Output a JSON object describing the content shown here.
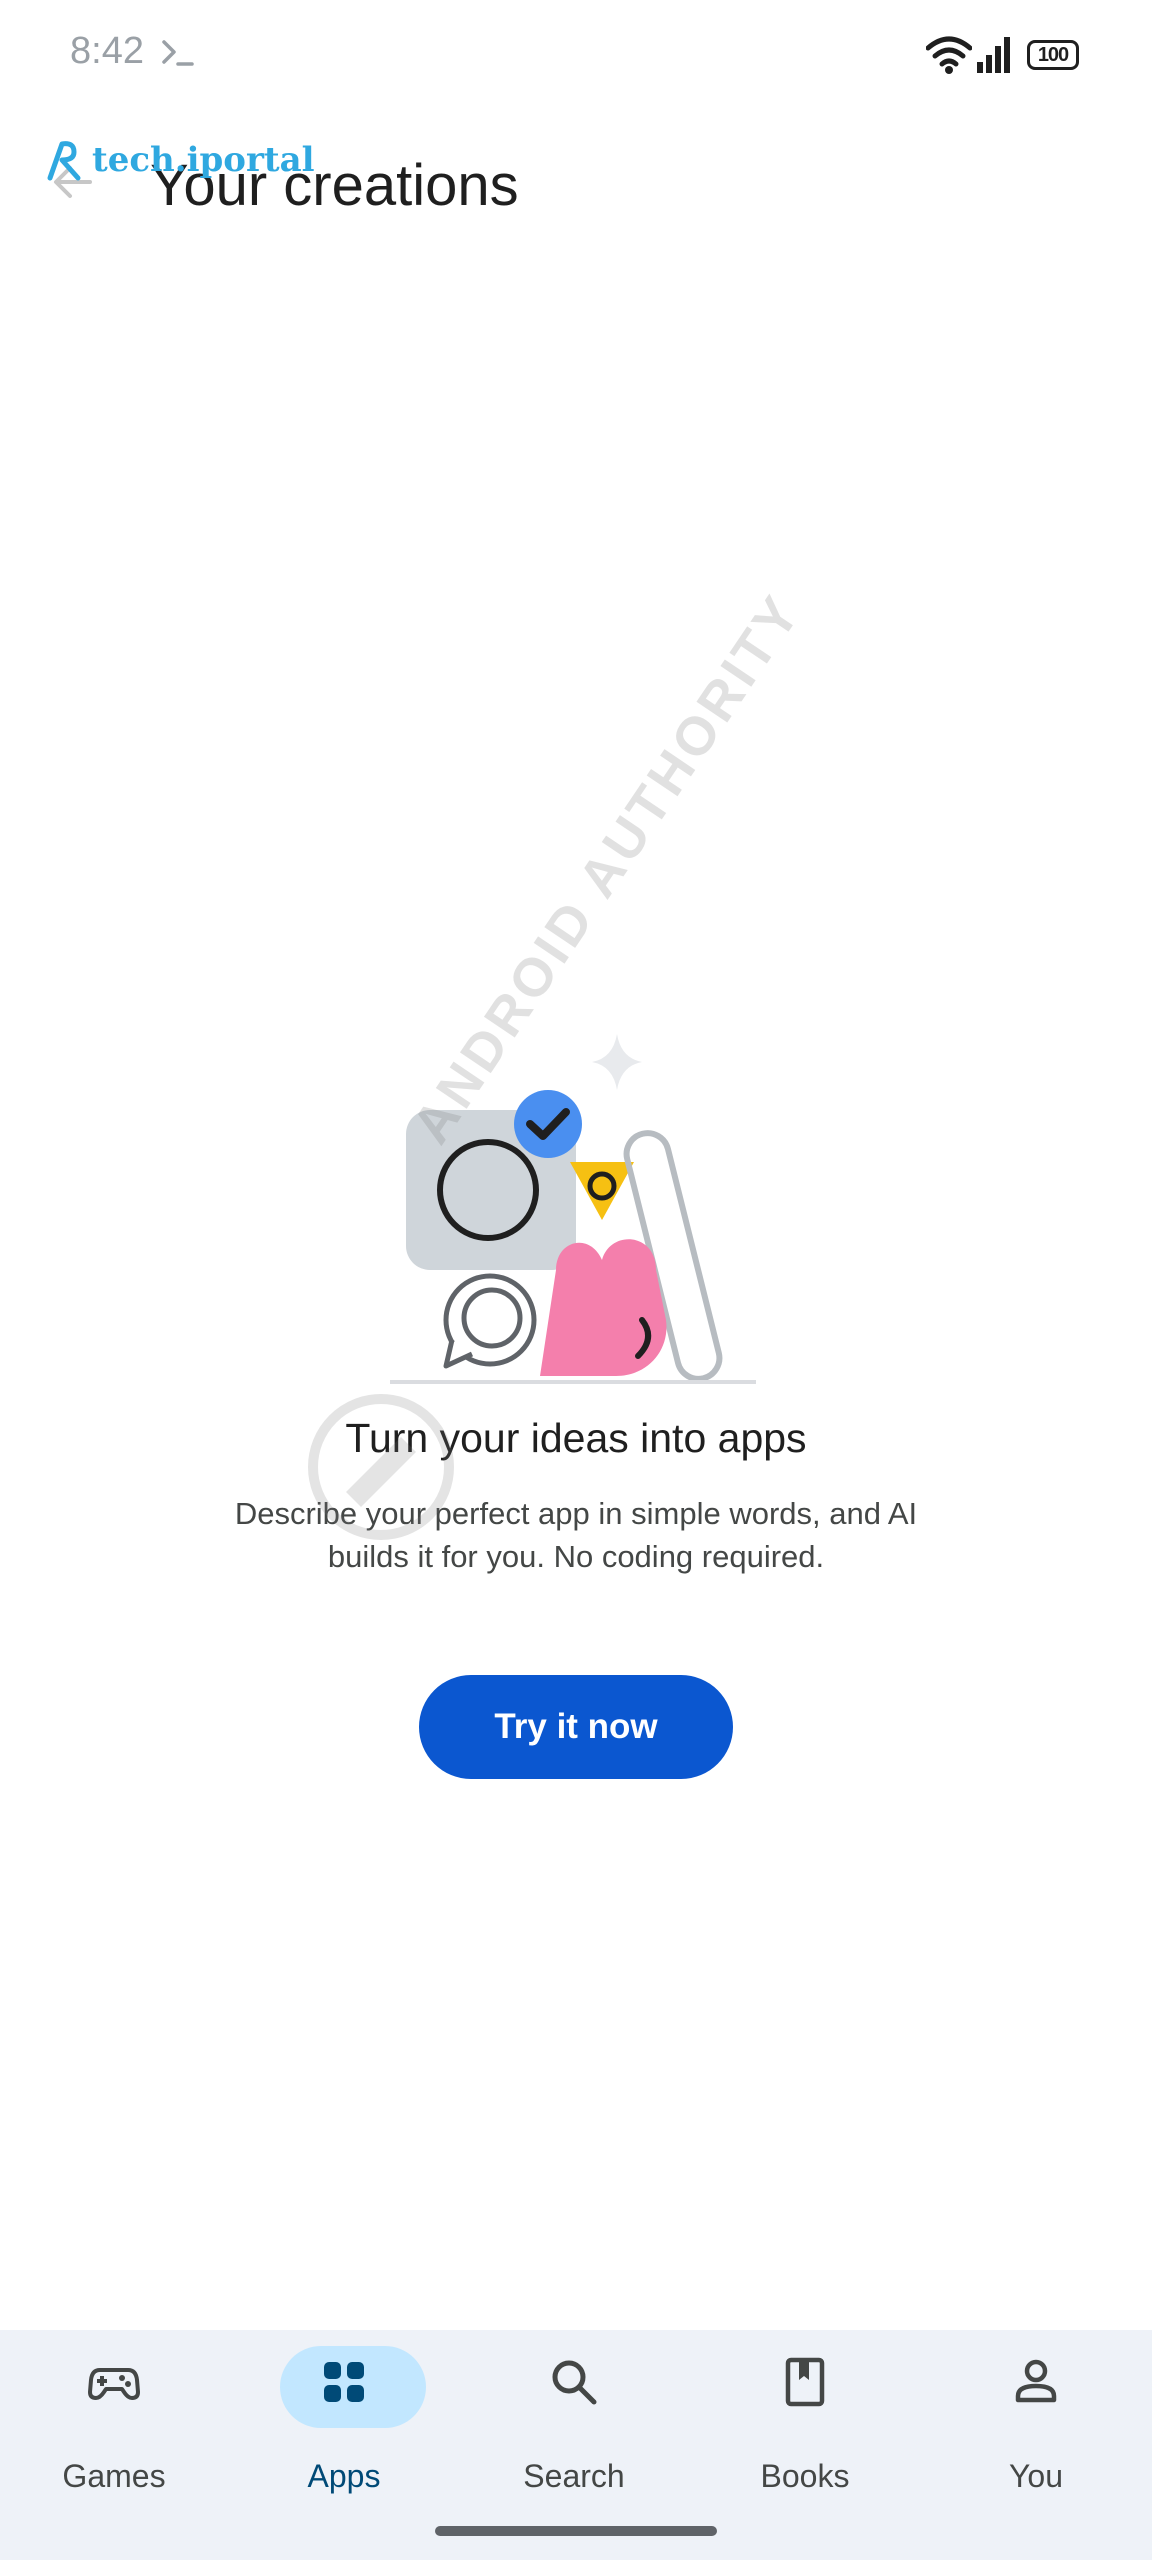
{
  "status_bar": {
    "time": "8:42",
    "battery": "100",
    "icons": [
      "terminal-icon",
      "wifi-icon",
      "signal-icon",
      "battery-icon"
    ]
  },
  "app_bar": {
    "title": "Your creations",
    "back_icon": "arrow-back-icon"
  },
  "watermarks": {
    "logo_text": "tech.iportal",
    "diagonal_text": "ANDROID AUTHORITY"
  },
  "empty_state": {
    "illustration": "apps-illustration",
    "title": "Turn your ideas into apps",
    "description": "Describe your perfect app in simple words, and AI builds it for you. No coding required.",
    "button_label": "Try it now"
  },
  "bottom_nav": {
    "items": [
      {
        "label": "Games",
        "icon": "gamepad-icon",
        "active": false
      },
      {
        "label": "Apps",
        "icon": "apps-grid-icon",
        "active": true
      },
      {
        "label": "Search",
        "icon": "search-icon",
        "active": false
      },
      {
        "label": "Books",
        "icon": "bookmark-book-icon",
        "active": false
      },
      {
        "label": "You",
        "icon": "person-icon",
        "active": false
      }
    ]
  },
  "colors": {
    "primary": "#0b57d0",
    "nav_background": "#eef2f8",
    "active_pill": "#c2e7ff",
    "heart": "#f47fac",
    "triangle": "#f6c012",
    "check_badge": "#4a8ff0"
  }
}
